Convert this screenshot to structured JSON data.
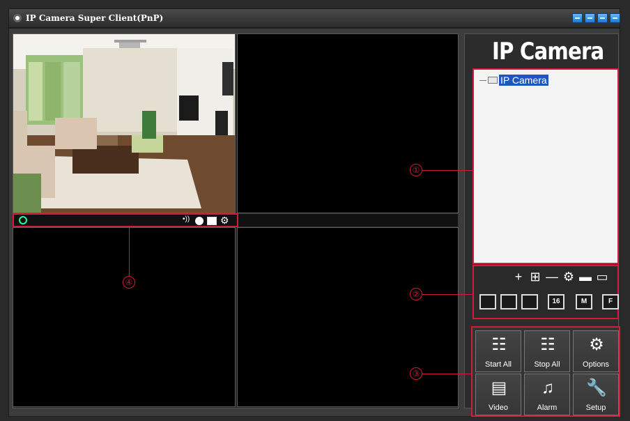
{
  "window": {
    "title": "IP Camera Super Client(PnP)",
    "controls": [
      "help",
      "minimize",
      "restore",
      "close"
    ]
  },
  "sidebar": {
    "brand_title": "IP Camera",
    "tree": {
      "label": "IP Camera"
    },
    "tools": [
      "+",
      "⊞",
      "—",
      "⚙",
      "▬",
      "▭"
    ],
    "layouts": [
      "",
      "",
      "",
      "16",
      "M",
      "F"
    ],
    "actions": [
      {
        "label": "Start All",
        "icon": "start-all-icon"
      },
      {
        "label": "Stop All",
        "icon": "stop-all-icon"
      },
      {
        "label": "Options",
        "icon": "options-icon"
      },
      {
        "label": "Video",
        "icon": "video-icon"
      },
      {
        "label": "Alarm",
        "icon": "alarm-icon"
      },
      {
        "label": "Setup",
        "icon": "setup-icon"
      }
    ]
  },
  "annotations": [
    "①",
    "②",
    "③",
    "④"
  ]
}
